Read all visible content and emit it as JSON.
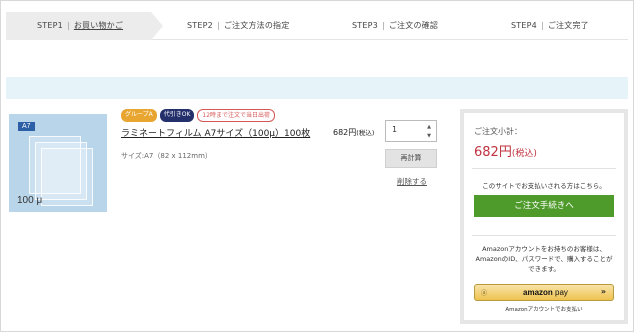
{
  "steps": [
    {
      "num": "STEP1",
      "label": "お買い物かご"
    },
    {
      "num": "STEP2",
      "label": "ご注文方法の指定"
    },
    {
      "num": "STEP3",
      "label": "ご注文の確認"
    },
    {
      "num": "STEP4",
      "label": "ご注文完了"
    }
  ],
  "product": {
    "image_badge": "A7",
    "image_size_label": "100 μ",
    "tags": [
      "グループA",
      "代引きOK",
      "12時まで注文で当日出荷"
    ],
    "name": "ラミネートフィルム A7サイズ（100μ）100枚",
    "size": "サイズ:A7（82 x 112mm）",
    "price": "682円",
    "price_tax": "(税込)",
    "quantity": "1",
    "recalc_label": "再計算",
    "delete_label": "削除する"
  },
  "summary": {
    "subtotal_label": "ご注文小計：",
    "total": "682円",
    "total_tax": "(税込)",
    "checkout_note": "このサイトでお支払いされる方はこちら。",
    "checkout_label": "ご注文手続きへ",
    "amazon_note": "Amazonアカウントをお持ちのお客様は、AmazonのID、パスワードで、購入することができます。",
    "amazon_brand": "amazon",
    "amazon_pay": "pay",
    "amazon_sub": "Amazonアカウントでお支払い"
  },
  "colors": {
    "accent_green": "#4e9a2a",
    "price_red": "#c0323f",
    "band_blue": "#e6f3f8"
  }
}
